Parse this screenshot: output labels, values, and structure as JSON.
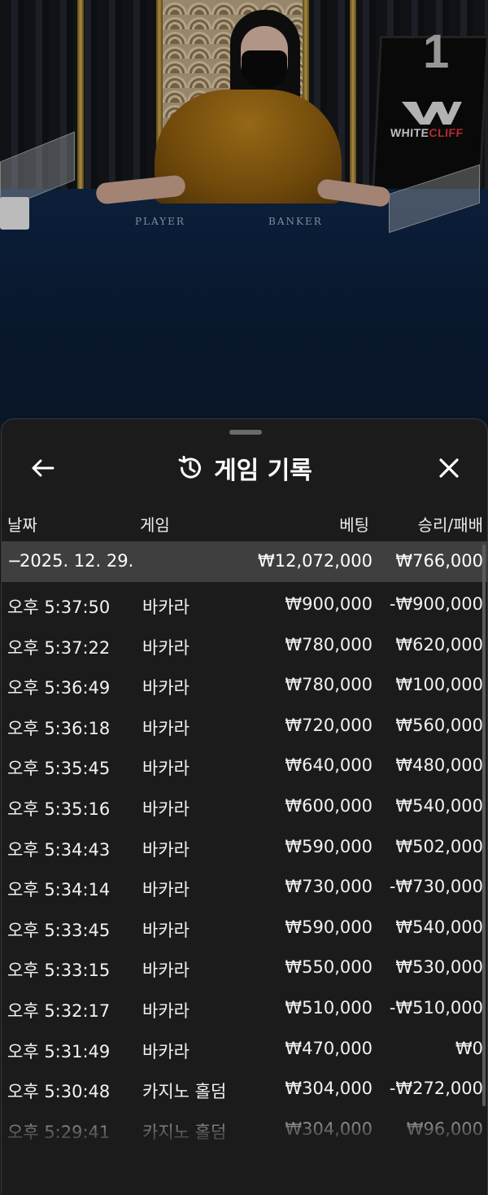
{
  "video": {
    "table_number": "1",
    "felt_left_label": "PLAYER",
    "felt_right_label": "BANKER",
    "brand_part1": "WHITE",
    "brand_part2": "CLIFF"
  },
  "sheet": {
    "title": "게임 기록",
    "icons": {
      "back": "arrow-left-icon",
      "history": "history-icon",
      "close": "close-icon"
    },
    "columns": {
      "date": "날짜",
      "game": "게임",
      "bet": "베팅",
      "win_loss": "승리/패배"
    },
    "day": {
      "toggle": "−",
      "date": "2025. 12. 29.",
      "bet_total": "₩12,072,000",
      "win_total": "₩766,000"
    },
    "rows": [
      {
        "time": "오후 5:37:50",
        "game": "바카라",
        "bet": "₩900,000",
        "win": "-₩900,000"
      },
      {
        "time": "오후 5:37:22",
        "game": "바카라",
        "bet": "₩780,000",
        "win": "₩620,000"
      },
      {
        "time": "오후 5:36:49",
        "game": "바카라",
        "bet": "₩780,000",
        "win": "₩100,000"
      },
      {
        "time": "오후 5:36:18",
        "game": "바카라",
        "bet": "₩720,000",
        "win": "₩560,000"
      },
      {
        "time": "오후 5:35:45",
        "game": "바카라",
        "bet": "₩640,000",
        "win": "₩480,000"
      },
      {
        "time": "오후 5:35:16",
        "game": "바카라",
        "bet": "₩600,000",
        "win": "₩540,000"
      },
      {
        "time": "오후 5:34:43",
        "game": "바카라",
        "bet": "₩590,000",
        "win": "₩502,000"
      },
      {
        "time": "오후 5:34:14",
        "game": "바카라",
        "bet": "₩730,000",
        "win": "-₩730,000"
      },
      {
        "time": "오후 5:33:45",
        "game": "바카라",
        "bet": "₩590,000",
        "win": "₩540,000"
      },
      {
        "time": "오후 5:33:15",
        "game": "바카라",
        "bet": "₩550,000",
        "win": "₩530,000"
      },
      {
        "time": "오후 5:32:17",
        "game": "바카라",
        "bet": "₩510,000",
        "win": "-₩510,000"
      },
      {
        "time": "오후 5:31:49",
        "game": "바카라",
        "bet": "₩470,000",
        "win": "₩0"
      },
      {
        "time": "오후 5:30:48",
        "game": "카지노 홀덤",
        "bet": "₩304,000",
        "win": "-₩272,000"
      },
      {
        "time": "오후 5:29:41",
        "game": "카지노 홀덤",
        "bet": "₩304,000",
        "win": "₩96,000"
      }
    ]
  }
}
